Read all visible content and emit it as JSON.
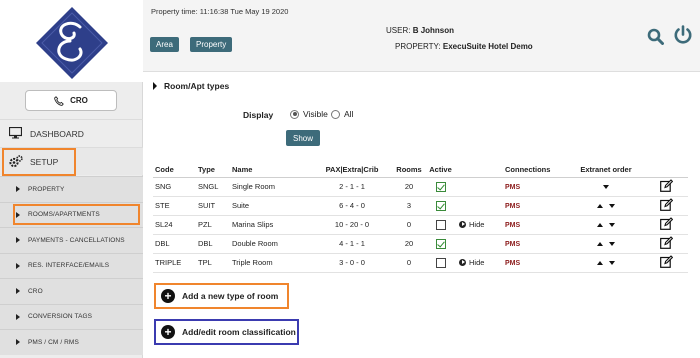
{
  "header": {
    "property_time": "Property time: 11:16:38 Tue May 19 2020",
    "area_label": "Area",
    "property_label": "Property",
    "user_label": "USER:",
    "user_name": "B Johnson",
    "property_key": "PROPERTY:",
    "property_name": "ExecuSuite Hotel Demo"
  },
  "sidebar": {
    "cro_button": "CRO",
    "dashboard": "DASHBOARD",
    "setup": "SETUP",
    "submenu": [
      "PROPERTY",
      "ROOMS/APARTMENTS",
      "PAYMENTS - CANCELLATIONS",
      "RES. INTERFACE/EMAILS",
      "CRO",
      "CONVERSION TAGS",
      "PMS / CM / RMS"
    ]
  },
  "main": {
    "section_title": "Room/Apt types",
    "display_label": "Display",
    "radio_visible": "Visible",
    "radio_all": "All",
    "show_button": "Show",
    "columns": [
      "Code",
      "Type",
      "Name",
      "PAX|Extra|Crib",
      "Rooms",
      "Active",
      "",
      "Connections",
      "Extranet order",
      ""
    ],
    "rows": [
      {
        "code": "SNG",
        "type": "SNGL",
        "name": "Single Room",
        "pax": "2 - 1 - 1",
        "rooms": "20",
        "active": true,
        "hide": "",
        "conn": "PMS",
        "order": "down"
      },
      {
        "code": "STE",
        "type": "SUIT",
        "name": "Suite",
        "pax": "6 - 4 - 0",
        "rooms": "3",
        "active": true,
        "hide": "",
        "conn": "PMS",
        "order": "both"
      },
      {
        "code": "SL24",
        "type": "PZL",
        "name": "Marina Slips",
        "pax": "10 - 20 - 0",
        "rooms": "0",
        "active": false,
        "hide": "Hide",
        "conn": "PMS",
        "order": "both"
      },
      {
        "code": "DBL",
        "type": "DBL",
        "name": "Double Room",
        "pax": "4 - 1 - 1",
        "rooms": "20",
        "active": true,
        "hide": "",
        "conn": "PMS",
        "order": "both"
      },
      {
        "code": "TRIPLE",
        "type": "TPL",
        "name": "Triple Room",
        "pax": "3 - 0 - 0",
        "rooms": "0",
        "active": false,
        "hide": "Hide",
        "conn": "PMS",
        "order": "both"
      }
    ],
    "add_room_button": "Add a new type of room",
    "classification_button": "Add/edit room classification"
  }
}
